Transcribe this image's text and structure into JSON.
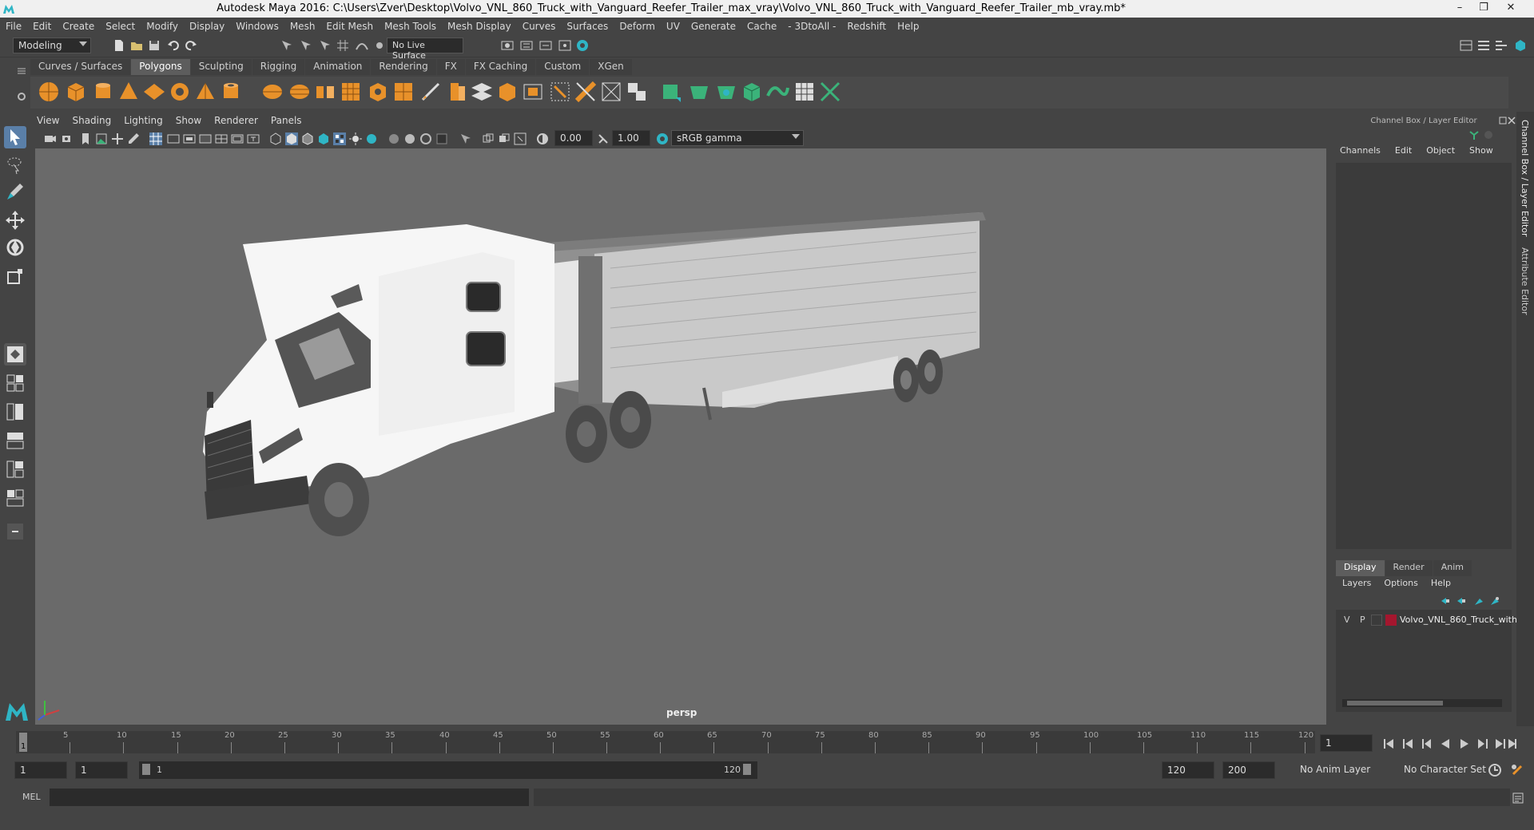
{
  "window": {
    "title": "Autodesk Maya 2016: C:\\Users\\Zver\\Desktop\\Volvo_VNL_860_Truck_with_Vanguard_Reefer_Trailer_max_vray\\Volvo_VNL_860_Truck_with_Vanguard_Reefer_Trailer_mb_vray.mb*",
    "minimize": "–",
    "restore": "❐",
    "close": "✕"
  },
  "menu": [
    "File",
    "Edit",
    "Create",
    "Select",
    "Modify",
    "Display",
    "Windows",
    "Mesh",
    "Edit Mesh",
    "Mesh Tools",
    "Mesh Display",
    "Curves",
    "Surfaces",
    "Deform",
    "UV",
    "Generate",
    "Cache",
    "- 3DtoAll -",
    "Redshift",
    "Help"
  ],
  "status": {
    "mode": "Modeling",
    "live_surface": "No Live Surface"
  },
  "shelf_tabs": [
    {
      "label": "Curves / Surfaces",
      "active": false
    },
    {
      "label": "Polygons",
      "active": true
    },
    {
      "label": "Sculpting",
      "active": false
    },
    {
      "label": "Rigging",
      "active": false
    },
    {
      "label": "Animation",
      "active": false
    },
    {
      "label": "Rendering",
      "active": false
    },
    {
      "label": "FX",
      "active": false
    },
    {
      "label": "FX Caching",
      "active": false
    },
    {
      "label": "Custom",
      "active": false
    },
    {
      "label": "XGen",
      "active": false
    }
  ],
  "viewport": {
    "menu": [
      "View",
      "Shading",
      "Lighting",
      "Show",
      "Renderer",
      "Panels"
    ],
    "near_value": "0.00",
    "far_value": "1.00",
    "color_space": "sRGB gamma",
    "camera_label": "persp"
  },
  "channel_box": {
    "header": "Channel Box / Layer Editor",
    "menu": [
      "Channels",
      "Edit",
      "Object",
      "Show"
    ]
  },
  "layer_editor": {
    "tabs": [
      "Display",
      "Render",
      "Anim"
    ],
    "active_tab": "Display",
    "menu": [
      "Layers",
      "Options",
      "Help"
    ],
    "layers": [
      {
        "v": "V",
        "p": "P",
        "color": "#a4162e",
        "name": "Volvo_VNL_860_Truck_with"
      }
    ]
  },
  "side_tabs": [
    "Channel Box / Layer Editor",
    "Attribute Editor"
  ],
  "timeline": {
    "ticks": [
      "5",
      "10",
      "15",
      "20",
      "25",
      "30",
      "35",
      "40",
      "45",
      "50",
      "55",
      "60",
      "65",
      "70",
      "75",
      "80",
      "85",
      "90",
      "95",
      "100",
      "105",
      "110",
      "115",
      "120"
    ],
    "start_label": "1",
    "current_frame": "1"
  },
  "range": {
    "start": "1",
    "playback_start": "1",
    "slider_start": "1",
    "slider_end": "120",
    "playback_end": "120",
    "end": "200",
    "anim_layer": "No Anim Layer",
    "character_set": "No Character Set"
  },
  "command_line": {
    "label": "MEL"
  },
  "colors": {
    "accent_cyan": "#2fb5c5",
    "shelf_orange": "#e8912a",
    "shelf_green": "#3bb37a",
    "layer_red": "#a4162e"
  }
}
